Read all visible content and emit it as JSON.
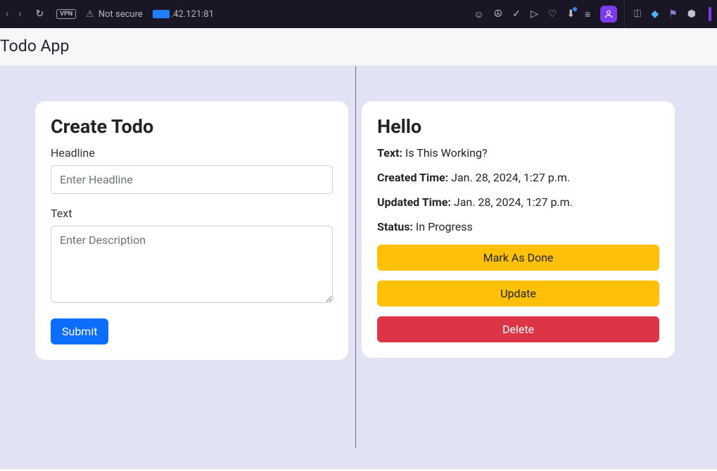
{
  "browser": {
    "vpn": "VPN",
    "not_secure": "Not secure",
    "address_suffix": ".42.121:81"
  },
  "header": {
    "title": "Todo App"
  },
  "create": {
    "title": "Create Todo",
    "headline_label": "Headline",
    "headline_placeholder": "Enter Headline",
    "text_label": "Text",
    "text_placeholder": "Enter Description",
    "submit_label": "Submit"
  },
  "todo": {
    "title": "Hello",
    "text_label": "Text:",
    "text_value": "Is This Working?",
    "created_label": "Created Time:",
    "created_value": "Jan. 28, 2024, 1:27 p.m.",
    "updated_label": "Updated Time:",
    "updated_value": "Jan. 28, 2024, 1:27 p.m.",
    "status_label": "Status:",
    "status_value": "In Progress",
    "mark_done_label": "Mark As Done",
    "update_label": "Update",
    "delete_label": "Delete"
  }
}
